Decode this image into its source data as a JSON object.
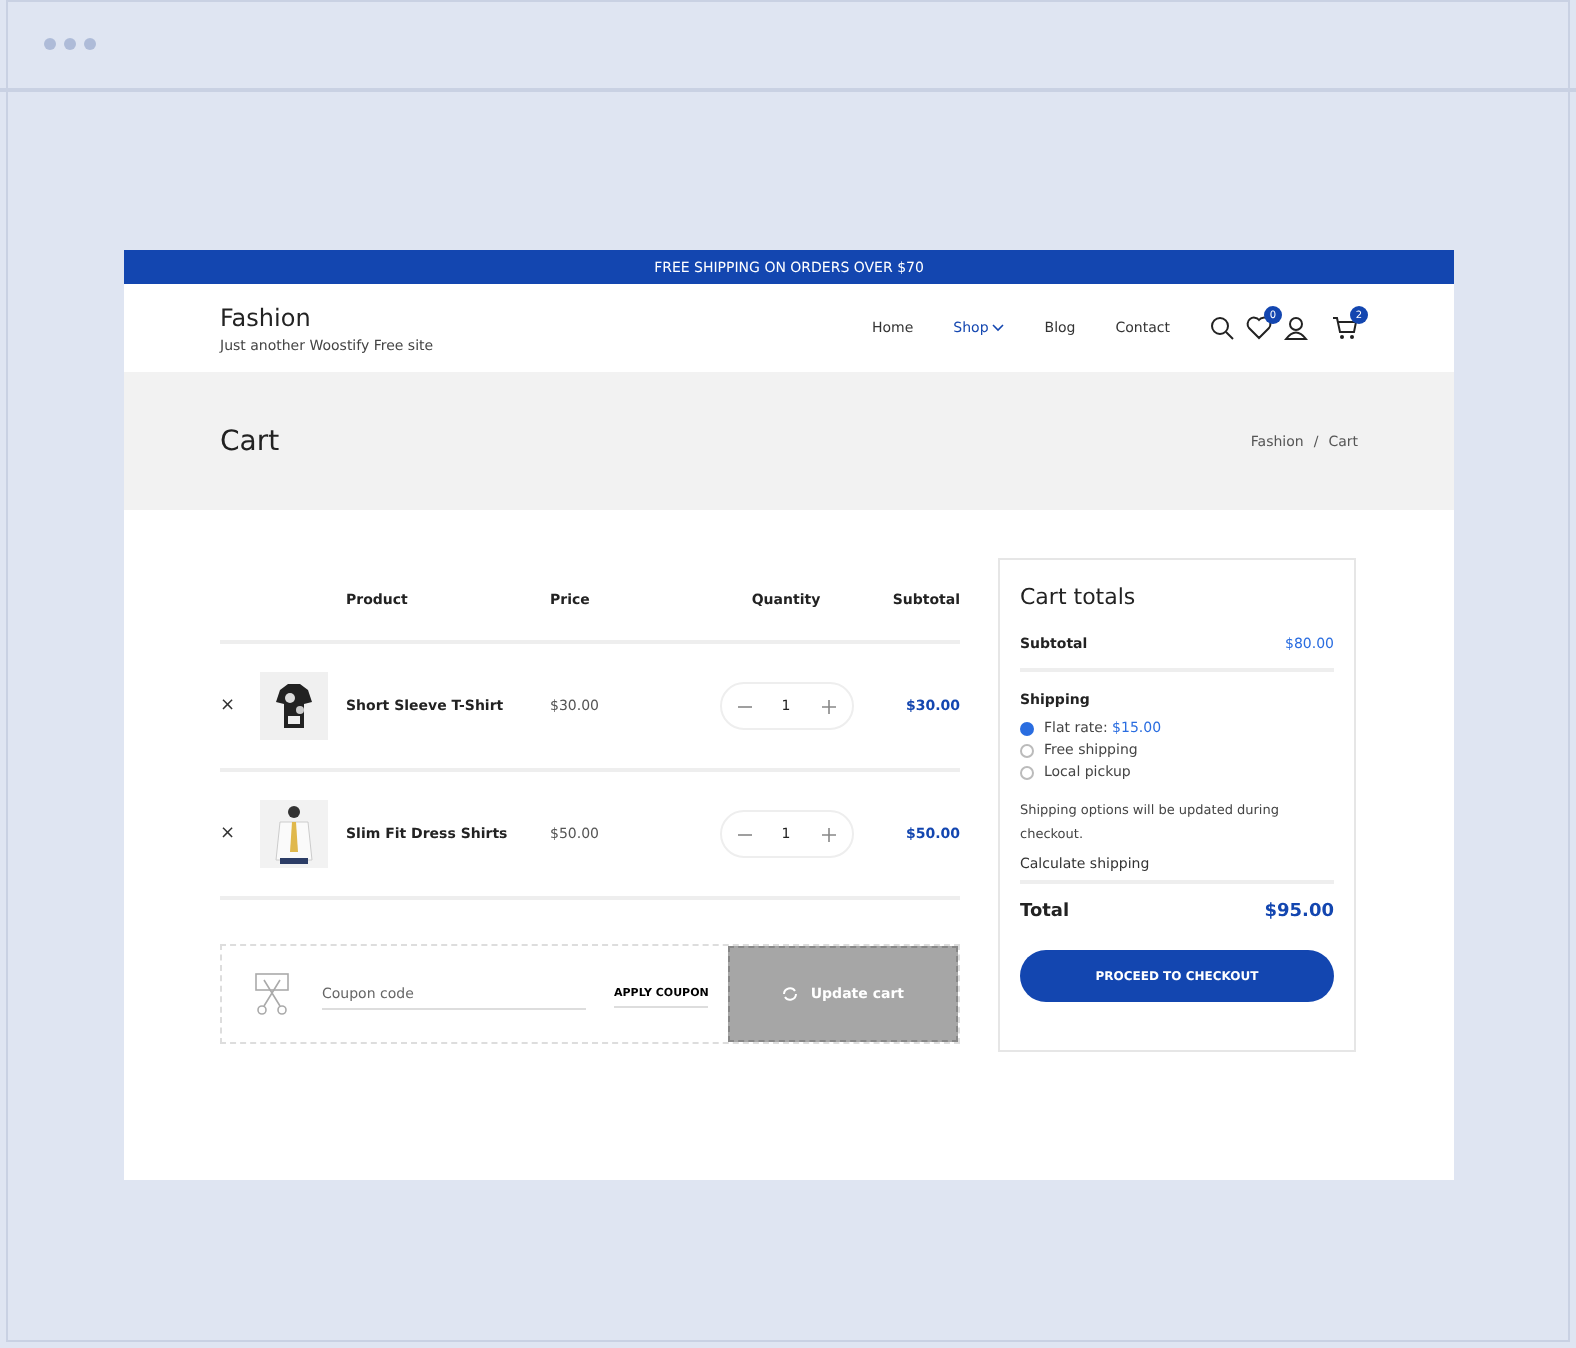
{
  "banner": "FREE SHIPPING ON ORDERS OVER $70",
  "site": {
    "title": "Fashion",
    "tagline": "Just another Woostify Free site"
  },
  "nav": [
    {
      "label": "Home",
      "selected": false,
      "dropdown": false
    },
    {
      "label": "Shop",
      "selected": true,
      "dropdown": true
    },
    {
      "label": "Blog",
      "selected": false,
      "dropdown": false
    },
    {
      "label": "Contact",
      "selected": false,
      "dropdown": false
    }
  ],
  "header_badges": {
    "wishlist": "0",
    "cart": "2"
  },
  "page_title": "Cart",
  "breadcrumb": [
    "Fashion",
    "Cart"
  ],
  "breadcrumb_separator": "/",
  "table": {
    "columns": [
      "Product",
      "Price",
      "Quantity",
      "Subtotal"
    ],
    "rows": [
      {
        "remove": "×",
        "product": "Short Sleeve T-Shirt",
        "price": "$30.00",
        "quantity": "1",
        "subtotal": "$30.00"
      },
      {
        "remove": "×",
        "product": "Slim Fit Dress Shirts",
        "price": "$50.00",
        "quantity": "1",
        "subtotal": "$50.00"
      }
    ]
  },
  "coupon": {
    "placeholder": "Coupon code",
    "apply": "APPLY COUPON",
    "update": "Update cart"
  },
  "totals": {
    "title": "Cart totals",
    "subtotal_label": "Subtotal",
    "subtotal": "$80.00",
    "shipping_label": "Shipping",
    "options": [
      {
        "label": "Flat rate:",
        "price": "$15.00",
        "selected": true
      },
      {
        "label": "Free shipping",
        "selected": false
      },
      {
        "label": "Local pickup",
        "selected": false
      }
    ],
    "note": "Shipping options will be updated during checkout.",
    "calculate": "Calculate shipping",
    "total_label": "Total",
    "total": "$95.00",
    "checkout": "PROCEED TO CHECKOUT"
  }
}
